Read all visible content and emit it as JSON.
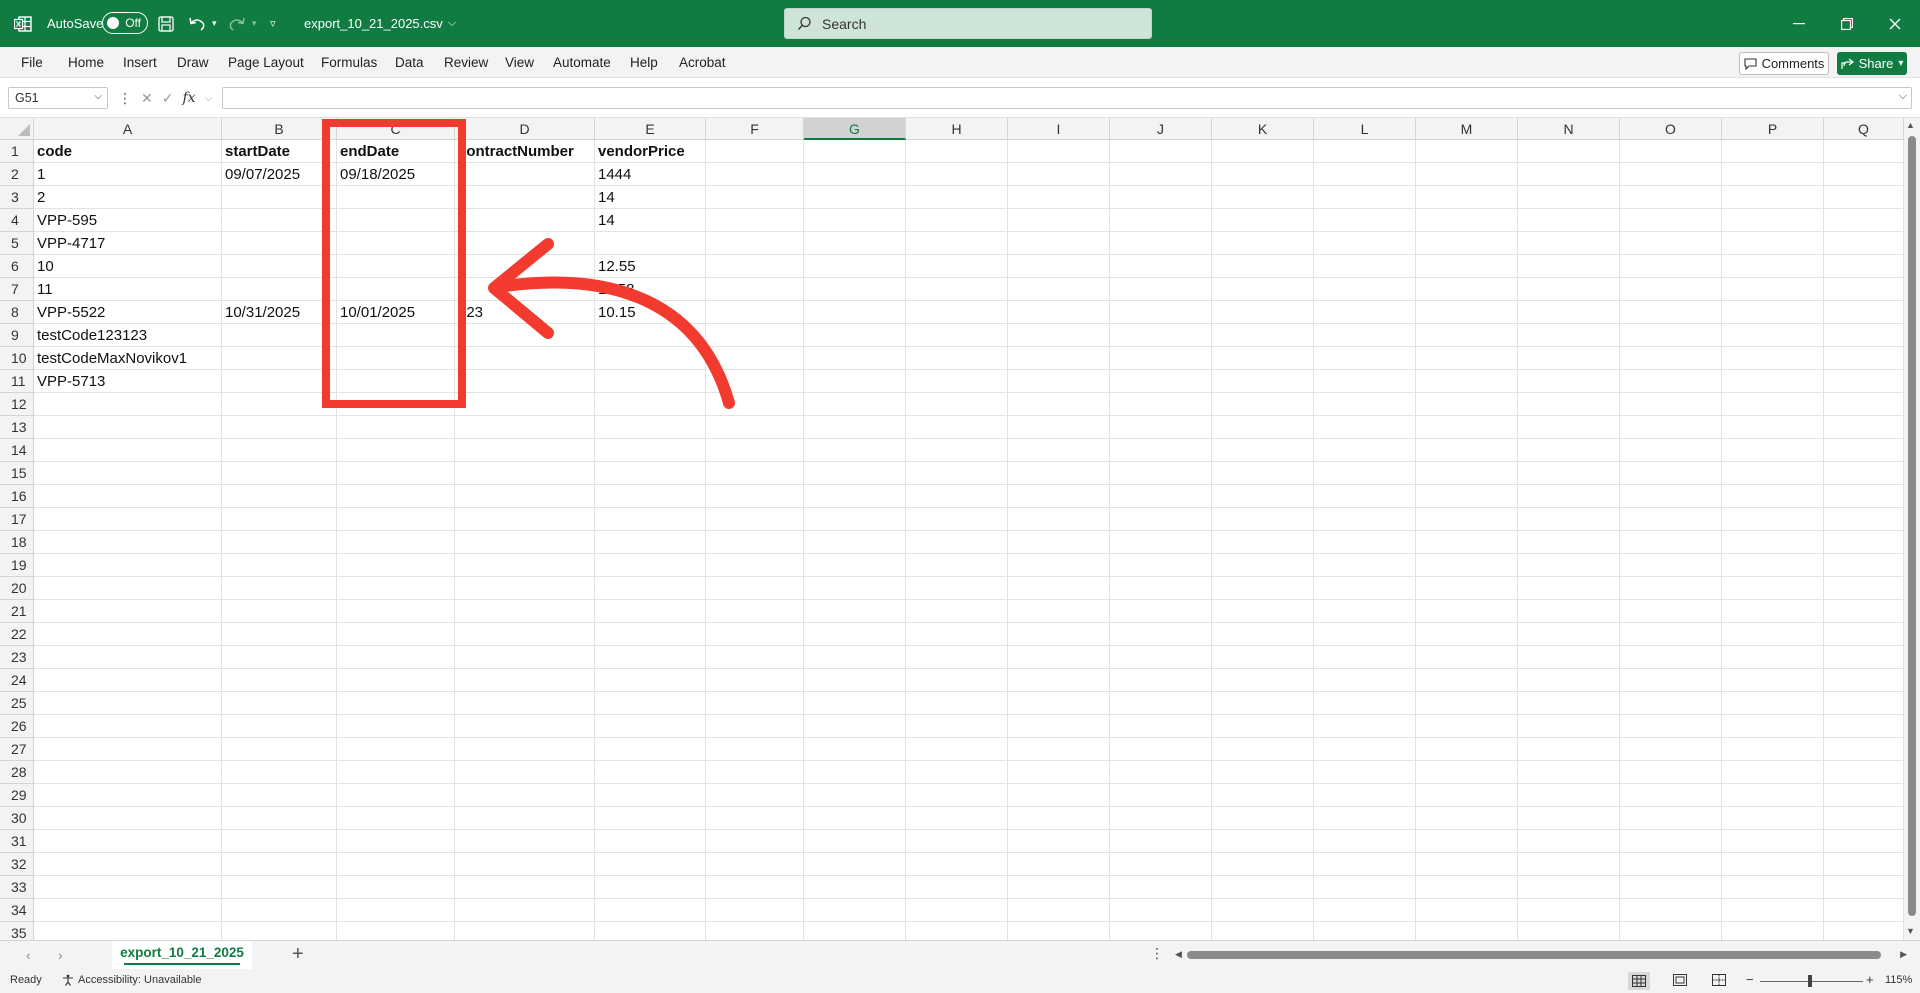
{
  "titlebar": {
    "autosave_label": "AutoSave",
    "autosave_state": "Off",
    "filename": "export_10_21_2025.csv",
    "search_placeholder": "Search"
  },
  "menu": [
    "File",
    "Home",
    "Insert",
    "Draw",
    "Page Layout",
    "Formulas",
    "Data",
    "Review",
    "View",
    "Automate",
    "Help",
    "Acrobat"
  ],
  "buttons": {
    "comments": "Comments",
    "share": "Share"
  },
  "formula": {
    "name_box": "G51",
    "fx": "fx",
    "value": ""
  },
  "columns": [
    "A",
    "B",
    "C",
    "D",
    "E",
    "F",
    "G",
    "H",
    "I",
    "J",
    "K",
    "L",
    "M",
    "N",
    "O",
    "P",
    "Q"
  ],
  "selected_column": "G",
  "rows": [
    "1",
    "2",
    "3",
    "4",
    "5",
    "6",
    "7",
    "8",
    "9",
    "10",
    "11",
    "12",
    "13",
    "14",
    "15",
    "16",
    "17",
    "18",
    "19",
    "20",
    "21",
    "22",
    "23",
    "24",
    "25",
    "26",
    "27",
    "28",
    "29",
    "30",
    "31",
    "32",
    "33",
    "34",
    "35"
  ],
  "cells": {
    "r1": {
      "a": "code",
      "b": "startDate",
      "c": "endDate",
      "d": "contractNumber",
      "e": "vendorPrice"
    },
    "r2": {
      "a": "1",
      "b": "09/07/2025",
      "c": "09/18/2025",
      "e": "1444"
    },
    "r3": {
      "a": "2",
      "e": "14"
    },
    "r4": {
      "a": "VPP-595",
      "e": "14"
    },
    "r5": {
      "a": "VPP-4717"
    },
    "r6": {
      "a": "10",
      "e": "12.55"
    },
    "r7": {
      "a": "11",
      "e": "11.58"
    },
    "r8": {
      "a": "VPP-5522",
      "b": "10/31/2025",
      "c": "10/01/2025",
      "d": "123",
      "e": "10.15"
    },
    "r9": {
      "a": "testCode123123"
    },
    "r10": {
      "a": "testCodeMaxNovikov1"
    },
    "r11": {
      "a": "VPP-5713"
    }
  },
  "sheet_tab": "export_10_21_2025",
  "status": {
    "ready": "Ready",
    "accessibility": "Accessibility: Unavailable",
    "zoom": "115%"
  },
  "annotation_color": "#f23a2e",
  "accent_color": "#107c41"
}
